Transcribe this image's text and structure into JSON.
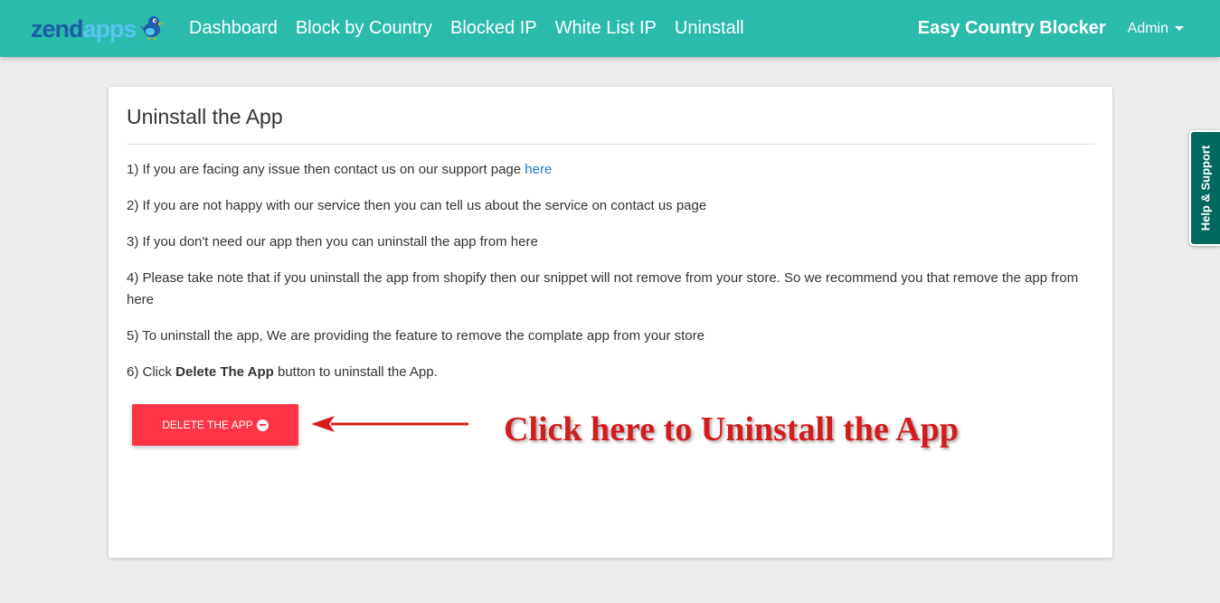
{
  "navbar": {
    "brand": {
      "part1": "zend",
      "part2": "apps"
    },
    "links": [
      "Dashboard",
      "Block by Country",
      "Blocked IP",
      "White List IP",
      "Uninstall"
    ],
    "app_name": "Easy Country Blocker",
    "user_menu": "Admin"
  },
  "card": {
    "title": "Uninstall the App",
    "steps": [
      {
        "text": "1) If you are facing any issue then contact us on our support page ",
        "link": "here"
      },
      {
        "text": "2) If you are not happy with our service then you can tell us about the service on contact us page"
      },
      {
        "text": "3) If you don't need our app then you can uninstall the app from here"
      },
      {
        "text": "4) Please take note that if you uninstall the app from shopify then our snippet will not remove from your store. So we recommend you that remove the app from here"
      },
      {
        "text": "5) To uninstall the app, We are providing the feature to remove the complate app from your store"
      },
      {
        "pre": "6) Click ",
        "bold": "Delete The App",
        "post": " button to uninstall the App."
      }
    ],
    "delete_button": "DELETE THE APP",
    "annotation": "Click here to Uninstall the App"
  },
  "help_tab": "Help & Support",
  "colors": {
    "navbar": "#2bbbad",
    "delete_button": "#ff3547",
    "annotation": "#d31d1d",
    "help_tab": "#00695c",
    "link": "#1e7bc6"
  },
  "icons": [
    "bird-logo-icon",
    "caret-down-icon",
    "minus-circle-icon",
    "arrow-left-icon"
  ]
}
